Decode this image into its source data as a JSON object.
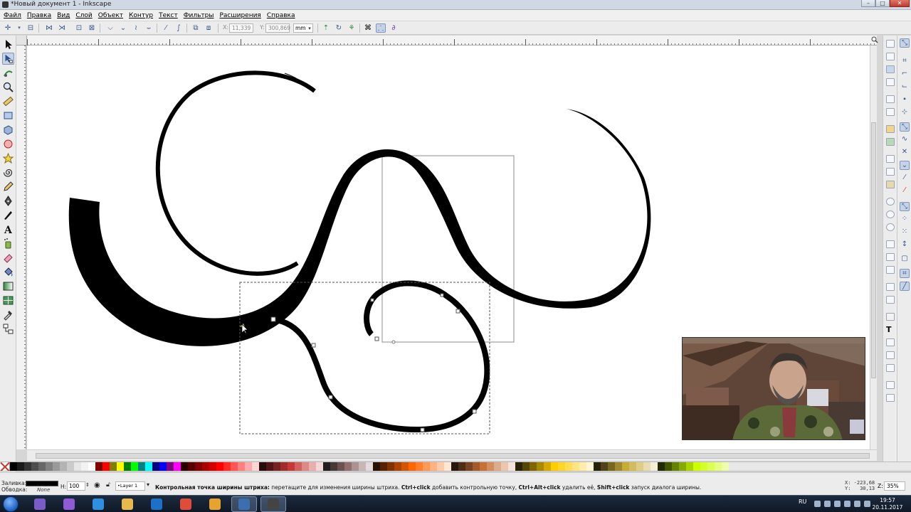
{
  "window": {
    "title": "*Новый документ 1 - Inkscape",
    "buttons": [
      "–",
      "□",
      "✕"
    ]
  },
  "menu": [
    {
      "label": "Файл"
    },
    {
      "label": "Правка"
    },
    {
      "label": "Вид"
    },
    {
      "label": "Слой"
    },
    {
      "label": "Объект"
    },
    {
      "label": "Контур"
    },
    {
      "label": "Текст"
    },
    {
      "label": "Фильтры"
    },
    {
      "label": "Расширения"
    },
    {
      "label": "Справка"
    }
  ],
  "tool_controls": {
    "x_label": "X:",
    "x_value": "11,339",
    "y_label": "Y:",
    "y_value": "300,869",
    "unit": "mm"
  },
  "tools": [
    {
      "name": "selector-tool"
    },
    {
      "name": "node-tool",
      "active": true
    },
    {
      "name": "tweak-tool"
    },
    {
      "name": "zoom-tool"
    },
    {
      "name": "measure-tool"
    },
    {
      "name": "rect-tool"
    },
    {
      "name": "3dbox-tool"
    },
    {
      "name": "ellipse-tool"
    },
    {
      "name": "star-tool"
    },
    {
      "name": "spiral-tool"
    },
    {
      "name": "pencil-tool"
    },
    {
      "name": "pen-tool"
    },
    {
      "name": "calligraphy-tool"
    },
    {
      "name": "text-tool"
    },
    {
      "name": "spray-tool"
    },
    {
      "name": "eraser-tool"
    },
    {
      "name": "bucket-tool"
    },
    {
      "name": "gradient-tool"
    },
    {
      "name": "mesh-tool"
    },
    {
      "name": "dropper-tool"
    },
    {
      "name": "connector-tool"
    }
  ],
  "status": {
    "fill_label": "Заливка:",
    "stroke_label": "Обводка:",
    "stroke_value": "None",
    "opacity_label": "Н:",
    "opacity_value": "100",
    "layer": "•Layer 1",
    "message_bold": "Контрольная точка ширины штриха:",
    "message_1": " перетащите для изменения ширины штриха. ",
    "message_ctrl": "Ctrl+click",
    "message_2": " добавить контрольную точку, ",
    "message_ctrl_alt": "Ctrl+Alt+click",
    "message_3": " удалить её, ",
    "message_shift": "Shift+click",
    "message_4": " запуск диалога ширины.",
    "coords_x": "X: -223,68",
    "coords_y": "Y:   30,13",
    "zoom_label": "Z:",
    "zoom_value": "35%"
  },
  "taskbar": {
    "language": "RU",
    "time": "19:57",
    "date": "20.11.2017",
    "apps": [
      {
        "name": "app-1",
        "color": "#7a5cc8"
      },
      {
        "name": "app-2",
        "color": "#8e5ad6"
      },
      {
        "name": "internet-explorer",
        "color": "#2e8fe0"
      },
      {
        "name": "file-explorer",
        "color": "#e8b84a"
      },
      {
        "name": "app-store",
        "color": "#1d6fc8"
      },
      {
        "name": "chrome",
        "color": "#e04b3a"
      },
      {
        "name": "media-player",
        "color": "#e8a230"
      },
      {
        "name": "screen-recorder",
        "color": "#3a6fb0",
        "active": true
      },
      {
        "name": "inkscape",
        "color": "#444444",
        "active": true
      }
    ]
  },
  "palette": [
    "#000000",
    "#1a1a1a",
    "#333333",
    "#4d4d4d",
    "#666666",
    "#808080",
    "#999999",
    "#b3b3b3",
    "#cccccc",
    "#e6e6e6",
    "#f2f2f2",
    "#ffffff",
    "#800000",
    "#ff0000",
    "#808000",
    "#ffff00",
    "#008000",
    "#00ff00",
    "#008080",
    "#00ffff",
    "#000080",
    "#0000ff",
    "#800080",
    "#ff00ff",
    "#2b0000",
    "#550000",
    "#800000",
    "#aa0000",
    "#d40000",
    "#ff0000",
    "#ff2a2a",
    "#ff5555",
    "#ff8080",
    "#ffaaaa",
    "#ffd5d5",
    "#280b0b",
    "#501616",
    "#782121",
    "#a02c2c",
    "#c83737",
    "#d35f5f",
    "#de8787",
    "#e9afaf",
    "#f4d7d7",
    "#241c1c",
    "#483737",
    "#6c5353",
    "#916f6f",
    "#ac9393",
    "#c8b7b7",
    "#e3dbdb",
    "#2b1100",
    "#552200",
    "#803300",
    "#aa4400",
    "#d45500",
    "#ff6600",
    "#ff7f2a",
    "#ff9955",
    "#ffb380",
    "#ffccaa",
    "#ffe6d5",
    "#28170b",
    "#502d16",
    "#784421",
    "#a05a2c",
    "#c87137",
    "#d38d5f",
    "#deaa87",
    "#e9c6af",
    "#f4e3d7",
    "#2b2200",
    "#554400",
    "#806600",
    "#aa8800",
    "#d4aa00",
    "#ffcc00",
    "#ffd42a",
    "#ffdd55",
    "#ffe680",
    "#ffeeaa",
    "#fff6d5",
    "#28220b",
    "#504416",
    "#786721",
    "#a0892c",
    "#c8ab37",
    "#d3bc5f",
    "#decd87",
    "#e9ddaf",
    "#f4eed7",
    "#222b00",
    "#445500",
    "#668000",
    "#88aa00",
    "#aad400",
    "#ccff00",
    "#d4ff2a",
    "#ddff55",
    "#e5ff80",
    "#eeffaa"
  ]
}
